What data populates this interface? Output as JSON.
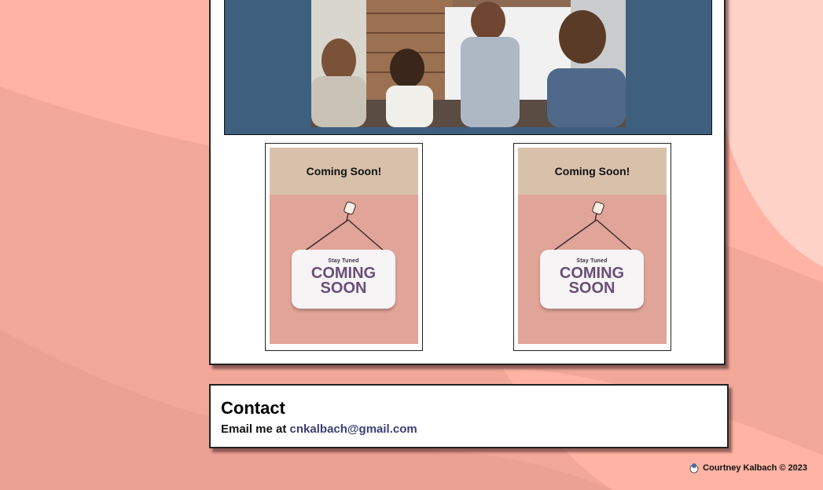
{
  "cards": [
    {
      "title": "Coming Soon!",
      "sign_small": "Stay Tuned",
      "sign_line1": "COMING",
      "sign_line2": "SOON"
    },
    {
      "title": "Coming Soon!",
      "sign_small": "Stay Tuned",
      "sign_line1": "COMING",
      "sign_line2": "SOON"
    }
  ],
  "contact": {
    "heading": "Contact",
    "prefix": "Email me at ",
    "email": "cnkalbach@gmail.com"
  },
  "footer": {
    "text": "Courtney Kalbach © 2023",
    "logo_icon": "bird-logo-icon"
  },
  "colors": {
    "background": "#f1a899",
    "hero": "#3e5f7e",
    "card_head": "#d8c1ab",
    "card_body": "#e0a498",
    "link": "#3b3f74"
  }
}
